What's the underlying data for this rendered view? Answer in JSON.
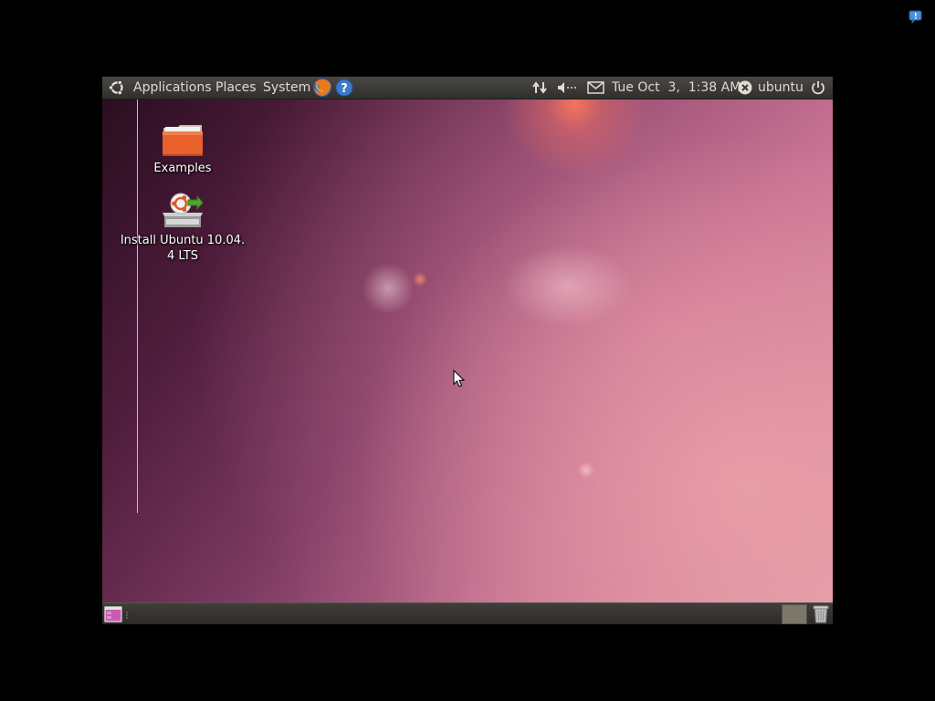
{
  "host": {
    "notification_icon": "speech-bubble-alert-icon"
  },
  "top_panel": {
    "logo_icon": "ubuntu-logo-icon",
    "menus": {
      "applications": "Applications",
      "places": "Places",
      "system": "System"
    },
    "launchers": [
      "firefox-icon",
      "help-icon"
    ],
    "indicators": [
      "network-icon",
      "volume-icon",
      "mail-icon"
    ],
    "clock": "Tue Oct  3,  1:38 AM",
    "user": "ubuntu",
    "power_icon": "power-icon"
  },
  "desktop": {
    "icons": [
      {
        "label": "Examples",
        "icon": "folder-icon"
      },
      {
        "label": "Install Ubuntu 10.04.\n4 LTS",
        "icon": "installer-icon"
      }
    ]
  },
  "bottom_panel": {
    "items": [
      "show-desktop-icon",
      "workspace-switcher",
      "trash-icon"
    ]
  },
  "colors": {
    "panel": "#3b3a37",
    "panel_text": "#dfdbd2",
    "folder_orange": "#e8602c",
    "wallpaper_dark": "#2a0e20",
    "wallpaper_light": "#e4a0aa"
  }
}
